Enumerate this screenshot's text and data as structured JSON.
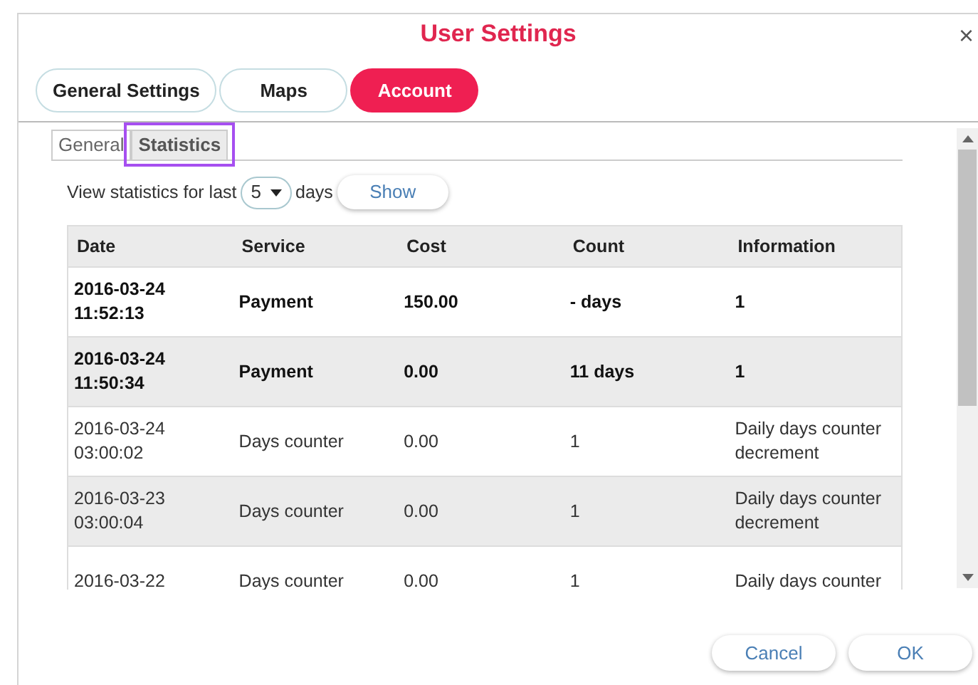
{
  "window": {
    "title": "User Settings",
    "close": "×"
  },
  "tabs": [
    {
      "label": "General Settings",
      "selected": false
    },
    {
      "label": "Maps",
      "selected": false
    },
    {
      "label": "Account",
      "selected": true
    }
  ],
  "subtabs": [
    {
      "label": "General",
      "selected": false
    },
    {
      "label": "Statistics",
      "selected": true
    }
  ],
  "filter": {
    "prefix": "View statistics for last",
    "value": "5",
    "suffix": "days",
    "button": "Show"
  },
  "table": {
    "columns": [
      "Date",
      "Service",
      "Cost",
      "Count",
      "Information"
    ],
    "rows": [
      {
        "bold": true,
        "cells": [
          "2016-03-24\n11:52:13",
          "Payment",
          "150.00",
          "- days",
          "1"
        ]
      },
      {
        "bold": true,
        "cells": [
          "2016-03-24\n11:50:34",
          "Payment",
          "0.00",
          "11 days",
          "1"
        ]
      },
      {
        "bold": false,
        "cells": [
          "2016-03-24\n03:00:02",
          "Days counter",
          "0.00",
          "1",
          "Daily days counter decrement"
        ]
      },
      {
        "bold": false,
        "cells": [
          "2016-03-23\n03:00:04",
          "Days counter",
          "0.00",
          "1",
          "Daily days counter decrement"
        ]
      },
      {
        "bold": false,
        "cells": [
          "2016-03-22",
          "Days counter",
          "0.00",
          "1",
          "Daily days counter"
        ]
      }
    ]
  },
  "buttons": [
    "Cancel",
    "OK"
  ]
}
